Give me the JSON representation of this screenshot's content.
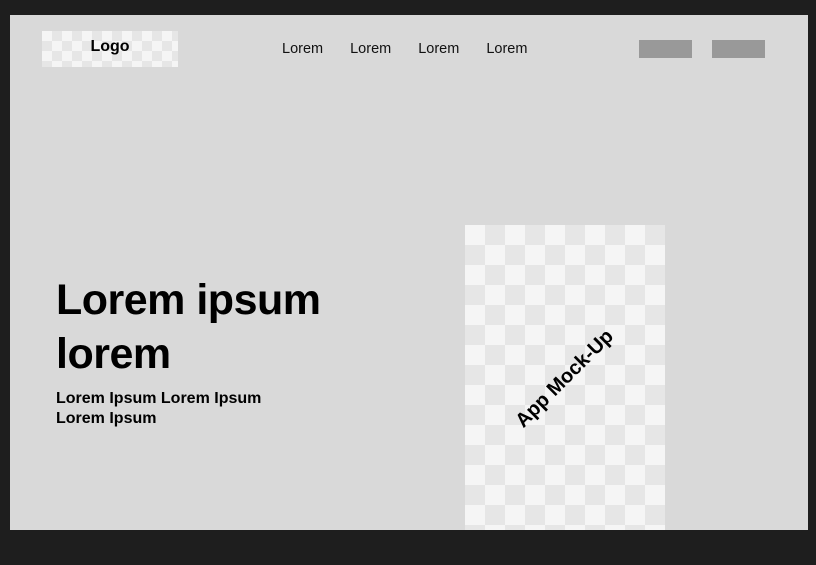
{
  "header": {
    "logo_text": "Logo",
    "nav": [
      "Lorem",
      "Lorem",
      "Lorem",
      "Lorem"
    ]
  },
  "hero": {
    "headline": "Lorem ipsum lorem",
    "subheadline": "Lorem Ipsum Lorem Ipsum Lorem Ipsum"
  },
  "mockup": {
    "label": "App Mock-Up"
  },
  "colors": {
    "page_bg": "#1e1e1e",
    "frame_bg": "#d9d9d9",
    "button_placeholder": "#999999",
    "checker_light": "#f5f5f5",
    "checker_dark": "#e6e6e6"
  }
}
